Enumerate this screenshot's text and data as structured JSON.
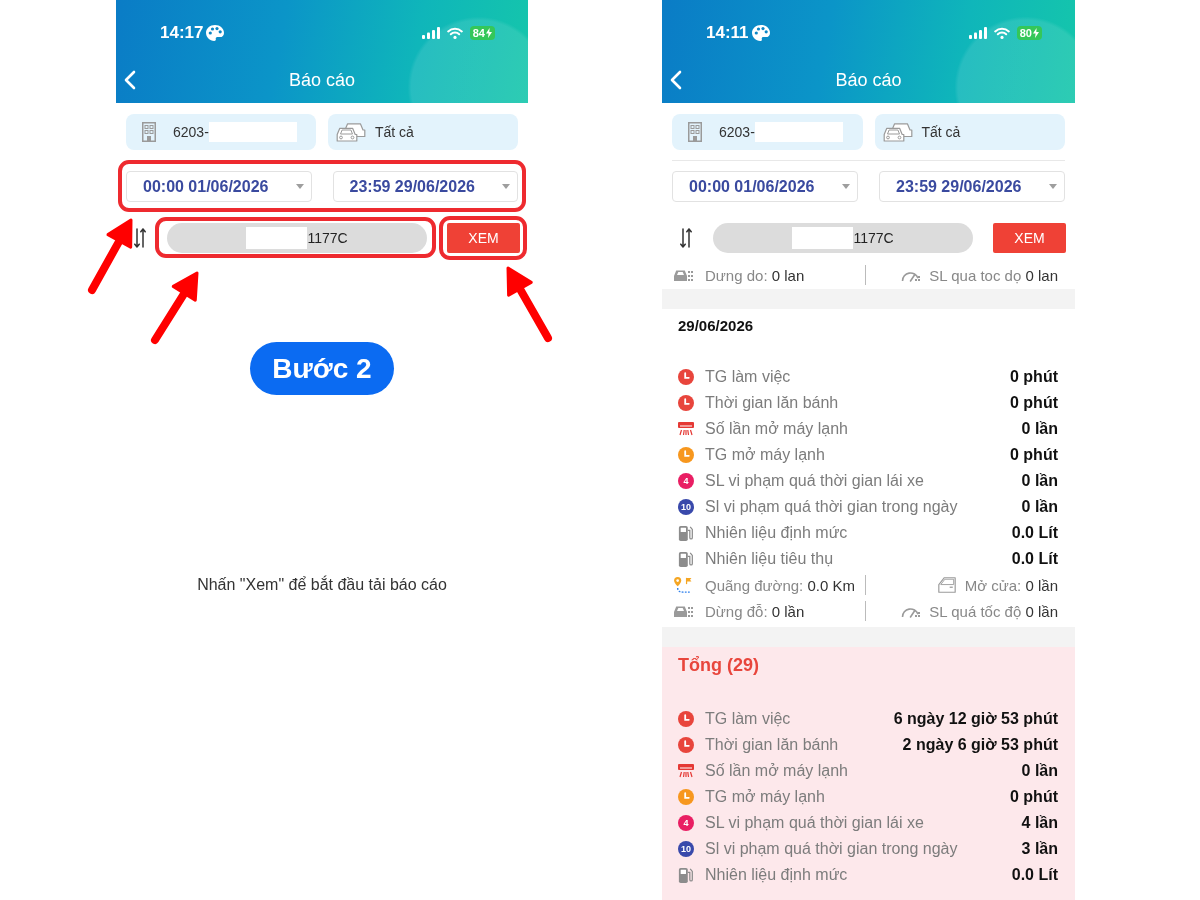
{
  "screens": [
    {
      "status_bar": {
        "time": "14:17",
        "battery": "84"
      },
      "nav": {
        "title": "Báo cáo"
      },
      "company": {
        "value": "6203-",
        "redacted": true
      },
      "vehicle_group": {
        "value": "Tất cả"
      },
      "date_range": {
        "from": "00:00 01/06/2026",
        "to": "23:59 29/06/2026",
        "highlighted": true
      },
      "vehicle": {
        "value": "1177C",
        "redacted": true,
        "highlighted": true
      },
      "view_button": {
        "label": "XEM",
        "highlighted": true
      },
      "step_badge": "Bước 2",
      "message": "Nhấn \"Xem\" để bắt đầu tải báo cáo"
    },
    {
      "status_bar": {
        "time": "14:11",
        "battery": "80"
      },
      "nav": {
        "title": "Báo cáo"
      },
      "company": {
        "value": "6203-",
        "redacted": true
      },
      "vehicle_group": {
        "value": "Tất cả"
      },
      "date_range": {
        "from": "00:00 01/06/2026",
        "to": "23:59 29/06/2026",
        "highlighted": false
      },
      "vehicle": {
        "value": "1177C",
        "redacted": true,
        "highlighted": false
      },
      "view_button": {
        "label": "XEM",
        "highlighted": false
      },
      "partial_stat_row": [
        {
          "kind": "parking",
          "label": "Dưng do:",
          "value": "0 lan"
        },
        {
          "kind": "speedometer",
          "label": "SL qua toc dọ",
          "value": "0 lan"
        }
      ],
      "reports": [
        {
          "kind": "day",
          "title": "29/06/2026",
          "metrics": [
            {
              "kind": "clock",
              "color": "#e8453c",
              "label": "TG làm việc",
              "value": "0 phút"
            },
            {
              "kind": "clock",
              "color": "#e8453c",
              "label": "Thời gian lăn bánh",
              "value": "0 phút"
            },
            {
              "kind": "ac",
              "label": "Số lần mở máy lạnh",
              "value": "0 lần"
            },
            {
              "kind": "clock",
              "color": "#f7971e",
              "label": "TG mở máy lạnh",
              "value": "0 phút"
            },
            {
              "kind": "badge",
              "badge": "4",
              "color": "#e91e63",
              "label": "SL vi phạm quá thời gian lái xe",
              "value": "0 lần"
            },
            {
              "kind": "badge",
              "badge": "10",
              "color": "#3949ab",
              "label": "Sl vi phạm quá thời gian trong ngày",
              "value": "0 lần"
            },
            {
              "kind": "fuel",
              "label": "Nhiên liệu định mức",
              "value": "0.0 Lít"
            },
            {
              "kind": "fuel",
              "label": "Nhiên liệu tiêu thụ",
              "value": "0.0 Lít"
            }
          ],
          "stat_rows": [
            [
              {
                "kind": "route",
                "label": "Quãng đường:",
                "value": "0.0 Km"
              },
              {
                "kind": "door",
                "label": "Mở cửa:",
                "value": "0 lần"
              }
            ],
            [
              {
                "kind": "parking",
                "label": "Dừng đỗ:",
                "value": "0 lần"
              },
              {
                "kind": "speedometer",
                "label": "SL quá tốc độ",
                "value": "0 lần"
              }
            ]
          ]
        },
        {
          "kind": "total",
          "title": "Tổng (29)",
          "metrics": [
            {
              "kind": "clock",
              "color": "#e8453c",
              "label": "TG làm việc",
              "value": "6 ngày 12 giờ 53 phút"
            },
            {
              "kind": "clock",
              "color": "#e8453c",
              "label": "Thời gian lăn bánh",
              "value": "2 ngày 6 giờ 53 phút"
            },
            {
              "kind": "ac",
              "label": "Số lần mở máy lạnh",
              "value": "0 lần"
            },
            {
              "kind": "clock",
              "color": "#f7971e",
              "label": "TG mở máy lạnh",
              "value": "0 phút"
            },
            {
              "kind": "badge",
              "badge": "4",
              "color": "#e91e63",
              "label": "SL vi phạm quá thời gian lái xe",
              "value": "4 lần"
            },
            {
              "kind": "badge",
              "badge": "10",
              "color": "#3949ab",
              "label": "Sl vi phạm quá thời gian trong ngày",
              "value": "3 lần"
            },
            {
              "kind": "fuel",
              "label": "Nhiên liệu định mức",
              "value": "0.0 Lít"
            }
          ]
        }
      ]
    }
  ]
}
